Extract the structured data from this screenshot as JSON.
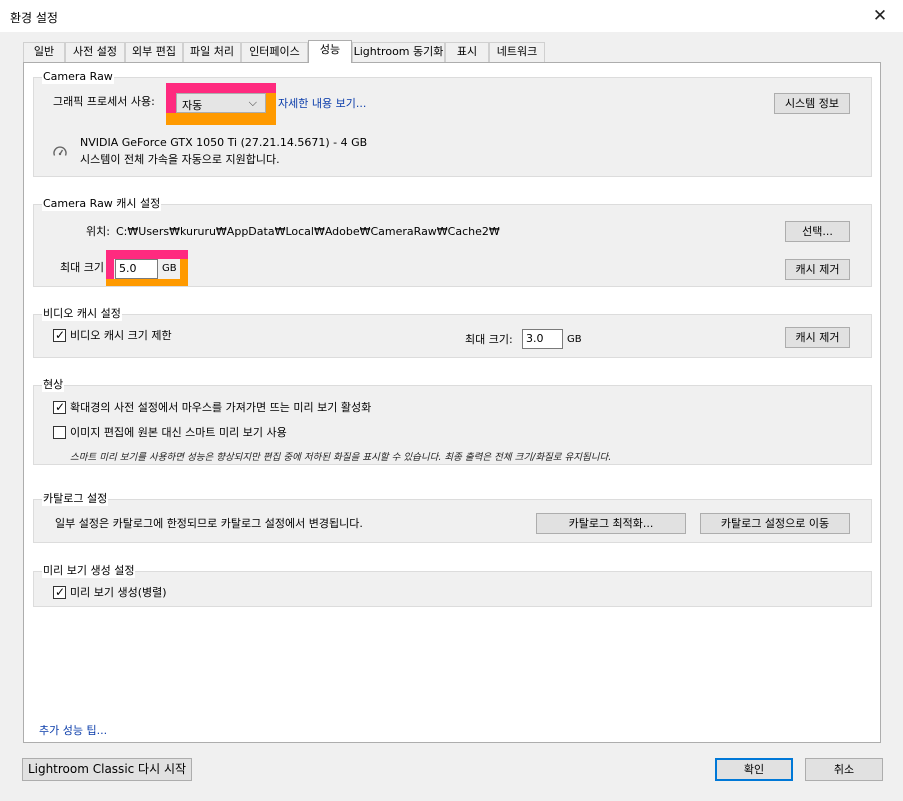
{
  "window": {
    "title": "환경 설정",
    "close_label": "✕"
  },
  "tabs": [
    {
      "label": "일반",
      "active": false
    },
    {
      "label": "사전 설정",
      "active": false
    },
    {
      "label": "외부 편집",
      "active": false
    },
    {
      "label": "파일 처리",
      "active": false
    },
    {
      "label": "인터페이스",
      "active": false
    },
    {
      "label": "성능",
      "active": true
    },
    {
      "label": "Lightroom 동기화",
      "active": false
    },
    {
      "label": "표시",
      "active": false
    },
    {
      "label": "네트워크",
      "active": false
    }
  ],
  "camera_raw": {
    "group_label": "Camera Raw",
    "gpu_label": "그래픽 프로세서 사용:",
    "gpu_value": "자동",
    "details_link": "자세한 내용 보기...",
    "system_info_button": "시스템 정보",
    "gpu_name": "NVIDIA GeForce GTX 1050 Ti (27.21.14.5671) - 4 GB",
    "gpu_status": "시스템이 전체 가속을 자동으로 지원합니다."
  },
  "raw_cache": {
    "group_label": "Camera Raw 캐시 설정",
    "location_label": "위치:",
    "location_path": "C:₩Users₩kururu₩AppData₩Local₩Adobe₩CameraRaw₩Cache2₩",
    "choose_button": "선택...",
    "max_size_label": "최대 크기",
    "max_size_value": "5.0",
    "unit": "GB",
    "purge_button": "캐시 제거"
  },
  "video_cache": {
    "group_label": "비디오 캐시 설정",
    "limit_label": "비디오 캐시 크기 제한",
    "limit_checked": true,
    "max_size_label": "최대 크기:",
    "max_size_value": "3.0",
    "unit": "GB",
    "purge_button": "캐시 제거"
  },
  "develop": {
    "group_label": "현상",
    "hover_preview_label": "확대경의 사전 설정에서 마우스를 가져가면 뜨는 미리 보기 활성화",
    "hover_preview_checked": true,
    "smart_preview_label": "이미지 편집에 원본 대신 스마트 미리 보기 사용",
    "smart_preview_checked": false,
    "note": "스마트 미리 보기를 사용하면 성능은 향상되지만 편집 중에 저하된 화질을 표시할 수 있습니다. 최종 출력은 전체 크기/화질로 유지됩니다."
  },
  "catalog": {
    "group_label": "카탈로그 설정",
    "info": "일부 설정은 카탈로그에 한정되므로 카탈로그 설정에서 변경됩니다.",
    "optimize_button": "카탈로그 최적화...",
    "goto_settings_button": "카탈로그 설정으로 이동"
  },
  "preview_gen": {
    "group_label": "미리 보기 생성 설정",
    "parallel_label": "미리 보기 생성(병렬)",
    "parallel_checked": true
  },
  "footer": {
    "tips_link": "추가 성능 팁...",
    "restart_button": "Lightroom Classic 다시 시작",
    "ok_button": "확인",
    "cancel_button": "취소"
  },
  "colors": {
    "highlight_pink": "#ff2a7f",
    "highlight_orange": "#ff9a00",
    "link": "#0a3caa"
  }
}
